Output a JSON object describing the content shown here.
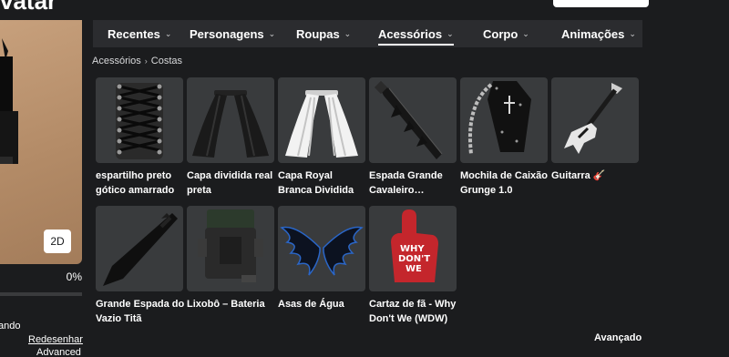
{
  "header": {
    "title_fragment": "vatar"
  },
  "preview": {
    "btn_2d": "2D",
    "progress_text": "0%",
    "side_line_1": "ando",
    "side_line_2": "Redesenhar",
    "side_line_3": "Advanced"
  },
  "tabs": [
    {
      "label": "Recentes",
      "active": false
    },
    {
      "label": "Personagens",
      "active": false
    },
    {
      "label": "Roupas",
      "active": false
    },
    {
      "label": "Acessórios",
      "active": true
    },
    {
      "label": "Corpo",
      "active": false
    },
    {
      "label": "Animações",
      "active": false
    }
  ],
  "breadcrumb": {
    "root": "Acessórios",
    "current": "Costas"
  },
  "items": [
    {
      "name": "espartilho preto gótico amarrado",
      "icon": "corset-icon"
    },
    {
      "name": "Capa dividida real preta",
      "icon": "black-cape-icon"
    },
    {
      "name": "Capa Royal Branca Dividida",
      "icon": "white-cape-icon"
    },
    {
      "name": "Espada Grande Cavaleiro Maligno…",
      "icon": "greatsword-icon"
    },
    {
      "name": "Mochila de Caixão Grunge 1.0",
      "icon": "coffin-backpack-icon"
    },
    {
      "name": "Guitarra 🎸",
      "icon": "guitar-icon"
    },
    {
      "name": "Grande Espada do Vazio Titã",
      "icon": "void-sword-icon"
    },
    {
      "name": "Lixobô – Bateria",
      "icon": "battery-robot-icon"
    },
    {
      "name": "Asas de Água",
      "icon": "water-wings-icon"
    },
    {
      "name": "Cartaz de fã - Why Don't We (WDW)",
      "icon": "fan-sign-icon"
    }
  ],
  "footer": {
    "advanced_label": "Avançado"
  }
}
